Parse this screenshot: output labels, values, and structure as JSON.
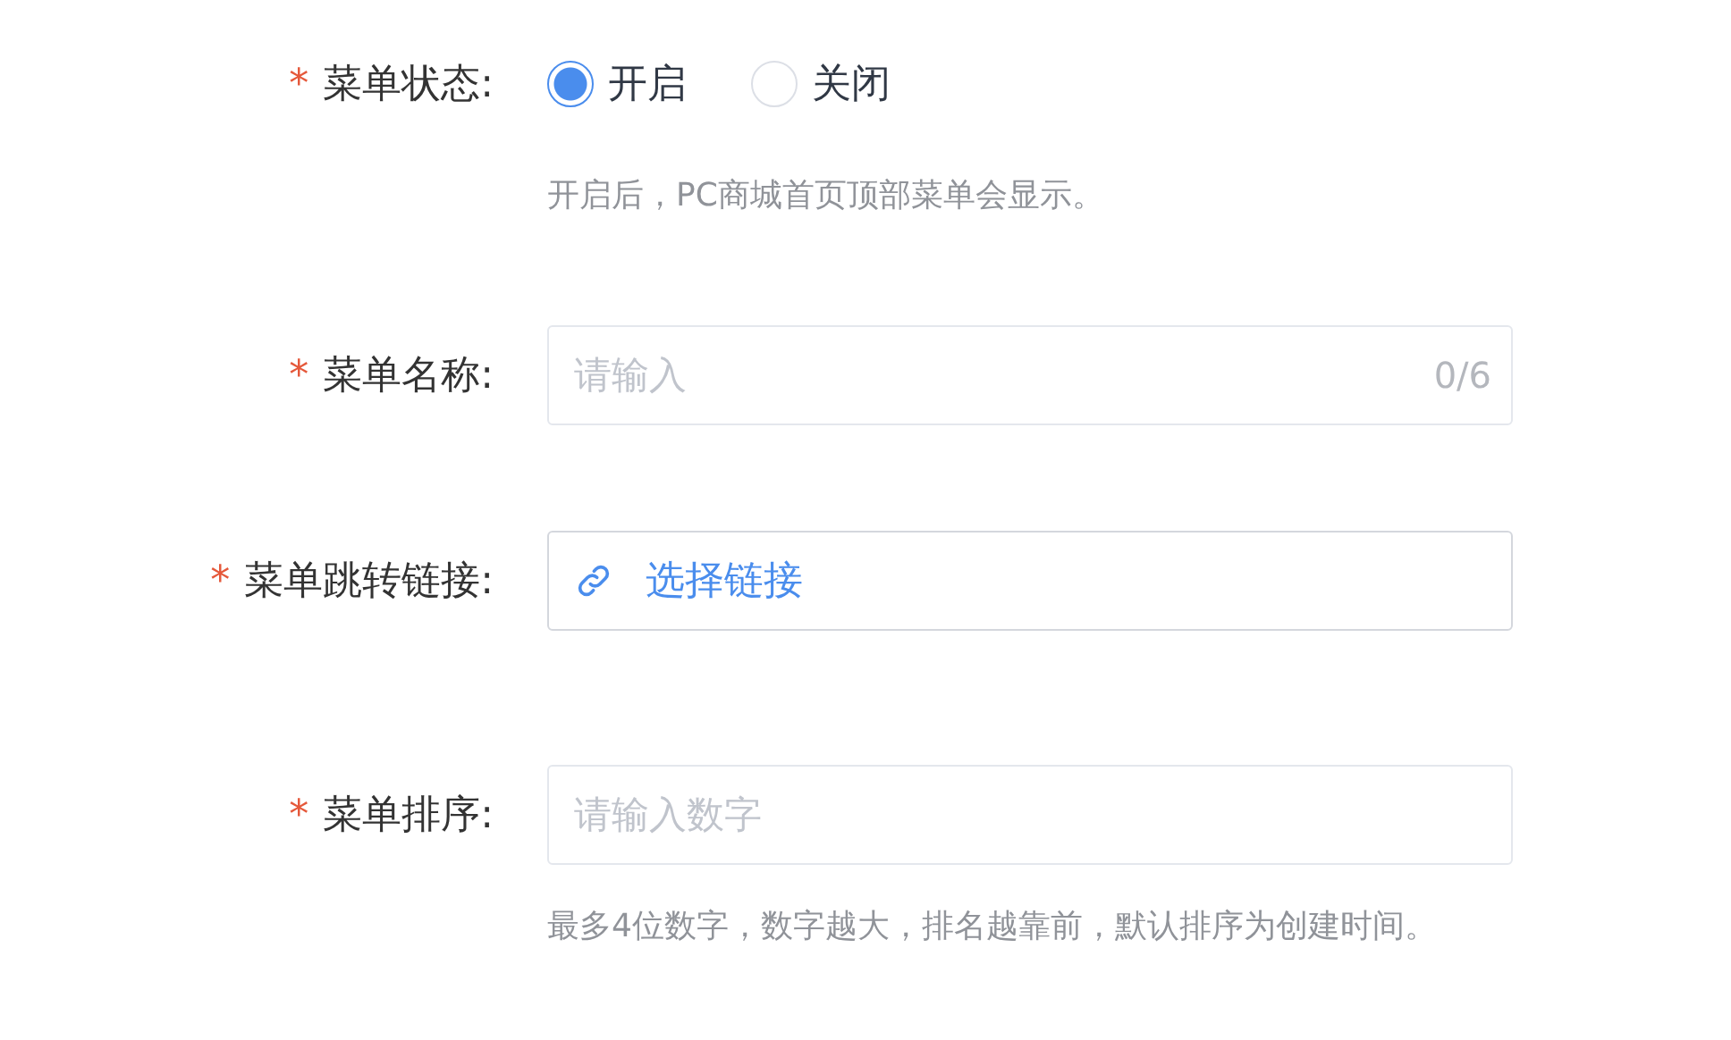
{
  "form": {
    "items": [
      {
        "kind": "radio",
        "label": "菜单状态:",
        "required_mark": "*",
        "options": [
          {
            "label": "开启",
            "selected": true
          },
          {
            "label": "关闭",
            "selected": false
          }
        ],
        "help": "开启后，PC商城首页顶部菜单会显示。"
      },
      {
        "kind": "text",
        "label": "菜单名称:",
        "required_mark": "*",
        "placeholder": "请输入",
        "counter": "0/6"
      },
      {
        "kind": "link",
        "label": "菜单跳转链接:",
        "required_mark": "*",
        "value": "选择链接"
      },
      {
        "kind": "number",
        "label": "菜单排序:",
        "required_mark": "*",
        "placeholder": "请输入数字",
        "help": "最多4位数字，数字越大，排名越靠前，默认排序为创建时间。"
      }
    ]
  }
}
